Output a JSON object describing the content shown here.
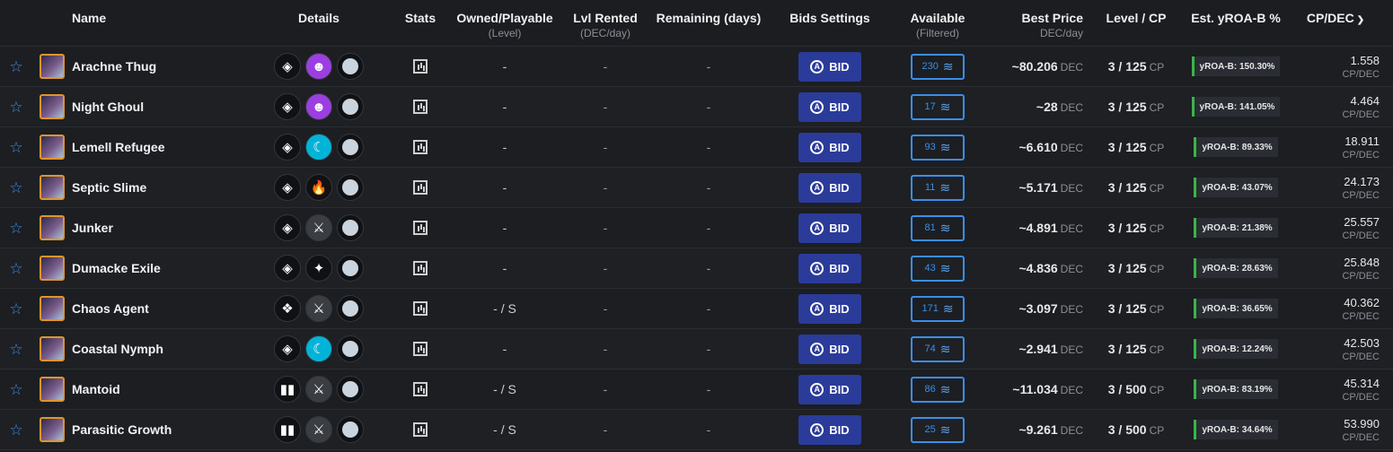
{
  "headers": {
    "name": "Name",
    "details": "Details",
    "stats": "Stats",
    "owned": "Owned/Playable",
    "owned_sub": "(Level)",
    "rented": "Lvl Rented",
    "rented_sub": "(DEC/day)",
    "remaining": "Remaining (days)",
    "bids": "Bids Settings",
    "available": "Available",
    "available_sub": "(Filtered)",
    "best_price": "Best Price",
    "best_price_sub": "DEC/day",
    "level_cp": "Level / CP",
    "yroa": "Est. yROA-B %",
    "cpdec": "CP/DEC",
    "sort_icon": "chevron-down-icon"
  },
  "labels": {
    "bid": "BID",
    "bid_icon_letter": "A",
    "dec": "DEC",
    "cp": "CP",
    "cpdec_unit": "CP/DEC",
    "info": "i"
  },
  "colors": {
    "accent_blue": "#3b8ee8",
    "bid_button": "#2b3b9a",
    "cart_button": "#1e90e8",
    "yroa_bar": "#39b54a",
    "avatar_border": "#e0952a"
  },
  "rows": [
    {
      "name": "Arachne Thug",
      "edition": "◈",
      "element": {
        "glyph": "☻",
        "bg": "#9b3fe0"
      },
      "owned": "-",
      "rented": "-",
      "remaining": "-",
      "available": "230",
      "price": "~80.206",
      "level": "3 / 125",
      "yroa": "yROA-B: 150.30%",
      "cpdec": "1.558"
    },
    {
      "name": "Night Ghoul",
      "edition": "◈",
      "element": {
        "glyph": "☻",
        "bg": "#9b3fe0"
      },
      "owned": "-",
      "rented": "-",
      "remaining": "-",
      "available": "17",
      "price": "~28",
      "level": "3 / 125",
      "yroa": "yROA-B: 141.05%",
      "cpdec": "4.464"
    },
    {
      "name": "Lemell Refugee",
      "edition": "◈",
      "element": {
        "glyph": "☾",
        "bg": "#00b4d8"
      },
      "owned": "-",
      "rented": "-",
      "remaining": "-",
      "available": "93",
      "price": "~6.610",
      "level": "3 / 125",
      "yroa": "yROA-B: 89.33%",
      "cpdec": "18.911"
    },
    {
      "name": "Septic Slime",
      "edition": "◈",
      "element": {
        "glyph": "🔥",
        "bg": "#101114"
      },
      "owned": "-",
      "rented": "-",
      "remaining": "-",
      "available": "11",
      "price": "~5.171",
      "level": "3 / 125",
      "yroa": "yROA-B: 43.07%",
      "cpdec": "24.173"
    },
    {
      "name": "Junker",
      "edition": "◈",
      "element": {
        "glyph": "⚔",
        "bg": "#3a3d42"
      },
      "owned": "-",
      "rented": "-",
      "remaining": "-",
      "available": "81",
      "price": "~4.891",
      "level": "3 / 125",
      "yroa": "yROA-B: 21.38%",
      "cpdec": "25.557"
    },
    {
      "name": "Dumacke Exile",
      "edition": "◈",
      "element": {
        "glyph": "✦",
        "bg": "#101114"
      },
      "owned": "-",
      "rented": "-",
      "remaining": "-",
      "available": "43",
      "price": "~4.836",
      "level": "3 / 125",
      "yroa": "yROA-B: 28.63%",
      "cpdec": "25.848"
    },
    {
      "name": "Chaos Agent",
      "edition": "❖",
      "element": {
        "glyph": "⚔",
        "bg": "#3a3d42"
      },
      "owned": "- / S",
      "rented": "-",
      "remaining": "-",
      "available": "171",
      "price": "~3.097",
      "level": "3 / 125",
      "yroa": "yROA-B: 36.65%",
      "cpdec": "40.362"
    },
    {
      "name": "Coastal Nymph",
      "edition": "◈",
      "element": {
        "glyph": "☾",
        "bg": "#00b4d8"
      },
      "owned": "-",
      "rented": "-",
      "remaining": "-",
      "available": "74",
      "price": "~2.941",
      "level": "3 / 125",
      "yroa": "yROA-B: 12.24%",
      "cpdec": "42.503"
    },
    {
      "name": "Mantoid",
      "edition": "▮▮",
      "element": {
        "glyph": "⚔",
        "bg": "#3a3d42"
      },
      "owned": "- / S",
      "rented": "-",
      "remaining": "-",
      "available": "86",
      "price": "~11.034",
      "level": "3 / 500",
      "yroa": "yROA-B: 83.19%",
      "cpdec": "45.314"
    },
    {
      "name": "Parasitic Growth",
      "edition": "▮▮",
      "element": {
        "glyph": "⚔",
        "bg": "#3a3d42"
      },
      "owned": "- / S",
      "rented": "-",
      "remaining": "-",
      "available": "25",
      "price": "~9.261",
      "level": "3 / 500",
      "yroa": "yROA-B: 34.64%",
      "cpdec": "53.990"
    }
  ]
}
